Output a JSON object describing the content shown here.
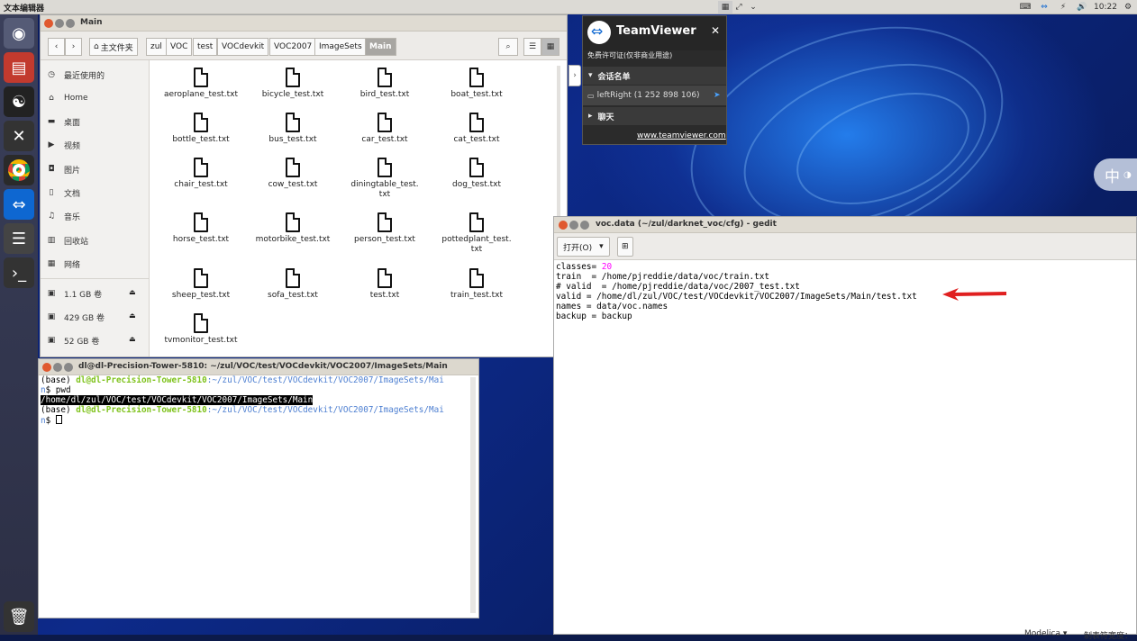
{
  "top_panel": {
    "app_title": "文本编辑器",
    "clock": "10:22"
  },
  "files_window": {
    "title": "Main",
    "breadcrumbs": [
      "主文件夹",
      "zul",
      "VOC",
      "test",
      "VOCdevkit",
      "VOC2007",
      "ImageSets",
      "Main"
    ],
    "sidebar": {
      "places": [
        {
          "label": "最近使用的",
          "icon": "clock-icon"
        },
        {
          "label": "Home",
          "icon": "home-icon"
        },
        {
          "label": "桌面",
          "icon": "folder-icon"
        },
        {
          "label": "视频",
          "icon": "video-icon"
        },
        {
          "label": "图片",
          "icon": "camera-icon"
        },
        {
          "label": "文档",
          "icon": "document-icon"
        },
        {
          "label": "音乐",
          "icon": "music-icon"
        },
        {
          "label": "回收站",
          "icon": "trash-icon"
        },
        {
          "label": "网络",
          "icon": "network-icon"
        }
      ],
      "volumes": [
        {
          "label": "1.1 GB 卷"
        },
        {
          "label": "429 GB 卷"
        },
        {
          "label": "52 GB 卷"
        }
      ]
    },
    "files": [
      "aeroplane_test.txt",
      "bicycle_test.txt",
      "bird_test.txt",
      "boat_test.txt",
      "bottle_test.txt",
      "bus_test.txt",
      "car_test.txt",
      "cat_test.txt",
      "chair_test.txt",
      "cow_test.txt",
      "diningtable_test.\ntxt",
      "dog_test.txt",
      "horse_test.txt",
      "motorbike_test.txt",
      "person_test.txt",
      "pottedplant_test.\ntxt",
      "sheep_test.txt",
      "sofa_test.txt",
      "test.txt",
      "train_test.txt",
      "tvmonitor_test.txt"
    ]
  },
  "teamviewer": {
    "name": "TeamViewer",
    "license": "免费许可证(仅非商业用途)",
    "section_sessions": "会话名单",
    "session_item": "leftRight (1 252 898 106)",
    "section_chat": "聊天",
    "link": "www.teamviewer.com"
  },
  "ime": {
    "label": "中"
  },
  "gedit": {
    "title": "voc.data (~/zul/darknet_voc/cfg) - gedit",
    "open_button": "打开(O)",
    "lines": {
      "l1_key": "classes= ",
      "l1_num": "20",
      "l2": "train  = /home/pjreddie/data/voc/train.txt",
      "l3": "# valid  = /home/pjreddie/data/voc/2007_test.txt",
      "l4": "valid = /home/dl/zul/VOC/test/VOCdevkit/VOC2007/ImageSets/Main/test.txt",
      "l5": "names = data/voc.names",
      "l6": "backup = backup"
    },
    "status_lang": "Modelica ▾",
    "status_tab": "制表符宽度："
  },
  "terminal": {
    "title": "dl@dl-Precision-Tower-5810: ~/zul/VOC/test/VOCdevkit/VOC2007/ImageSets/Main",
    "line1_prefix": "(base) ",
    "line1_host": "dl@dl-Precision-Tower-5810",
    "line1_path": ":~/zul/VOC/test/VOCdevkit/VOC2007/ImageSets/Mai",
    "line2_cont": "n",
    "line2_cmd": "$ pwd",
    "line3": "/home/dl/zul/VOC/test/VOCdevkit/VOC2007/ImageSets/Main",
    "line4_prefix": "(base) ",
    "line4_host": "dl@dl-Precision-Tower-5810",
    "line4_path": ":~/zul/VOC/test/VOCdevkit/VOC2007/ImageSets/Mai",
    "line5_cont": "n",
    "line5_prompt": "$ "
  },
  "colors": {
    "accent_orange": "#e0582e",
    "terminal_green": "#7ec21b",
    "terminal_blue": "#4d7fd1",
    "arrow_red": "#e02020",
    "number_magenta": "#ff00ff"
  }
}
